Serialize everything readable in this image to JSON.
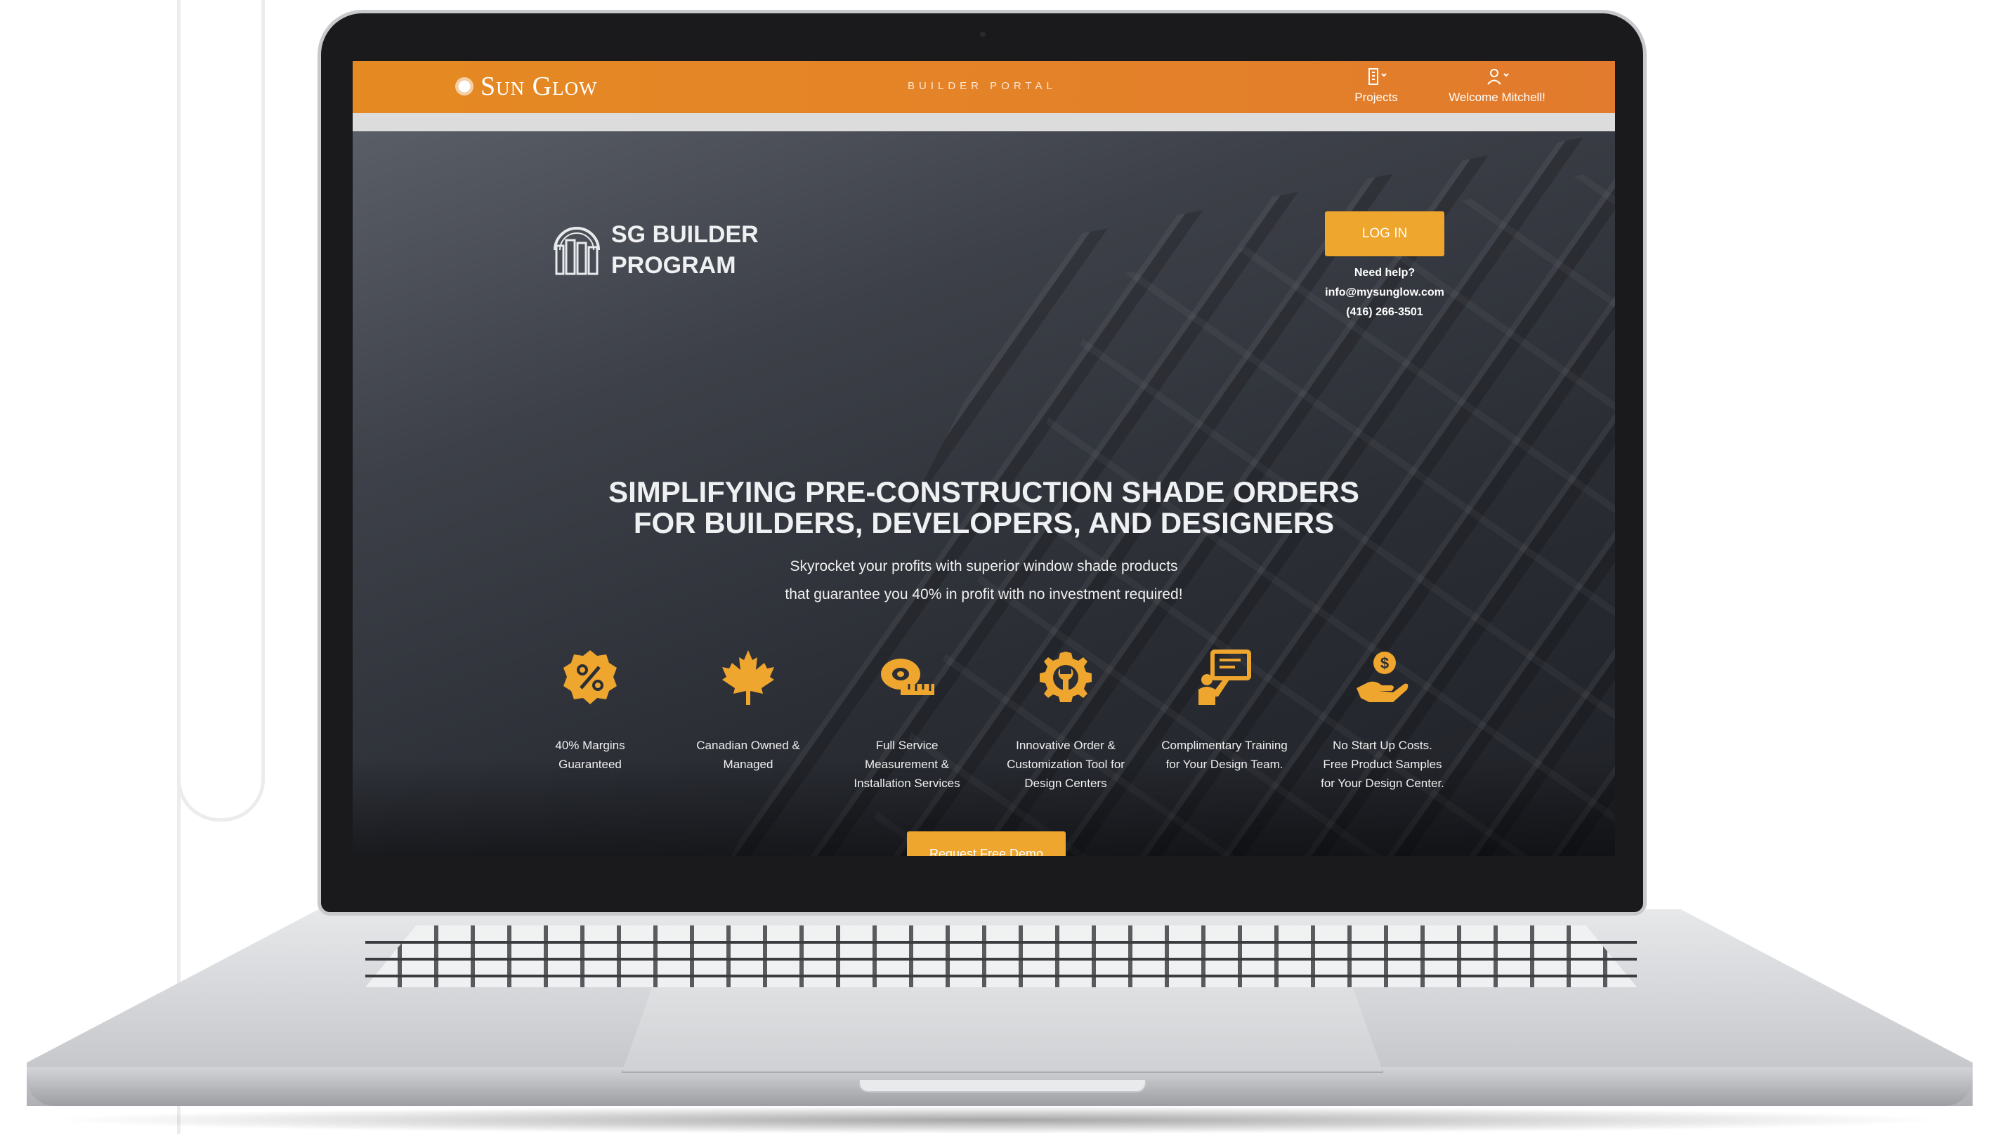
{
  "header": {
    "brand": "Sun Glow",
    "portal": "BUILDER PORTAL",
    "projects": "Projects",
    "welcome": "Welcome Mitchell!"
  },
  "hero": {
    "program_line1": "SG BUILDER",
    "program_line2": "PROGRAM",
    "login": "LOG IN",
    "help": {
      "title": "Need help?",
      "email": "info@mysunglow.com",
      "phone": "(416) 266-3501"
    },
    "headline_line1": "SIMPLIFYING PRE-CONSTRUCTION SHADE ORDERS",
    "headline_line2": "FOR BUILDERS, DEVELOPERS, AND DESIGNERS",
    "sub_line1": "Skyrocket your profits with superior window shade products",
    "sub_line2": "that guarantee you 40% in profit with no investment required!",
    "features": [
      {
        "icon": "percent-badge-icon",
        "l1": "40% Margins",
        "l2": "Guaranteed",
        "l3": ""
      },
      {
        "icon": "maple-leaf-icon",
        "l1": "Canadian Owned &",
        "l2": "Managed",
        "l3": ""
      },
      {
        "icon": "tape-measure-icon",
        "l1": "Full Service",
        "l2": "Measurement &",
        "l3": "Installation Services"
      },
      {
        "icon": "gear-wrench-icon",
        "l1": "Innovative Order &",
        "l2": "Customization Tool for",
        "l3": "Design Centers"
      },
      {
        "icon": "training-board-icon",
        "l1": "Complimentary Training",
        "l2": "for Your Design Team.",
        "l3": ""
      },
      {
        "icon": "hand-coin-icon",
        "l1": "No Start Up Costs.",
        "l2": "Free Product Samples",
        "l3": "for Your Design Center."
      }
    ],
    "demo": "Request Free Demo"
  },
  "colors": {
    "accent": "#eea62e",
    "topbar": "#e58a22"
  }
}
